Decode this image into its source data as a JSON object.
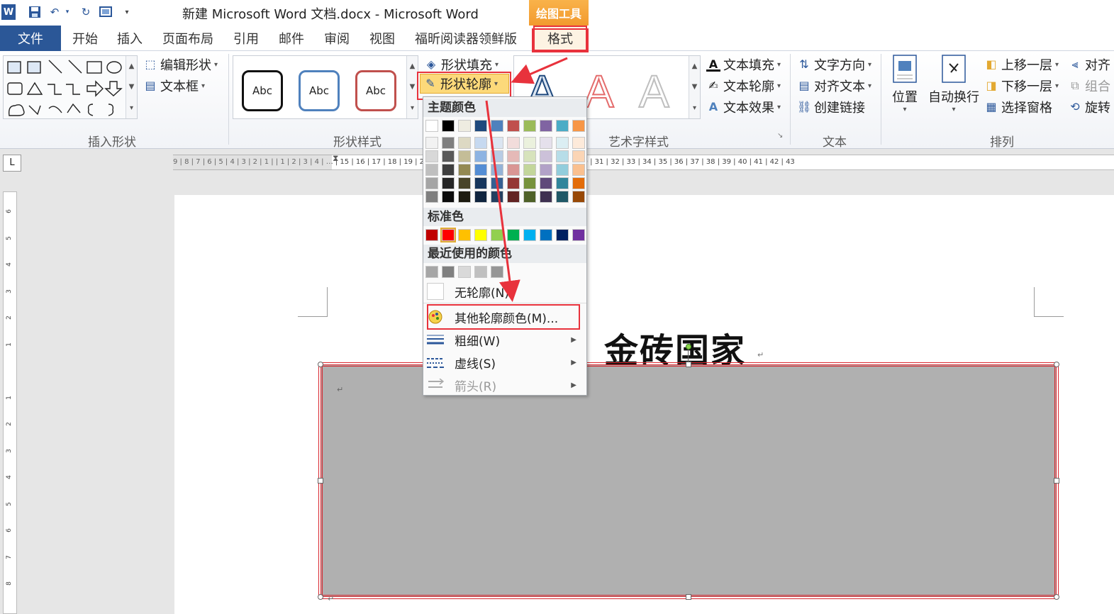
{
  "window": {
    "title": "新建 Microsoft Word 文档.docx - Microsoft Word",
    "context_tab": "绘图工具"
  },
  "quick_access": {
    "app_icon": "word-icon",
    "save_icon": "save-icon",
    "undo_icon": "undo-icon",
    "redo_icon": "redo-icon",
    "print_icon": "print-preview-icon",
    "customize_icon": "customize-icon"
  },
  "tabs": [
    {
      "label": "文件"
    },
    {
      "label": "开始"
    },
    {
      "label": "插入"
    },
    {
      "label": "页面布局"
    },
    {
      "label": "引用"
    },
    {
      "label": "邮件"
    },
    {
      "label": "审阅"
    },
    {
      "label": "视图"
    },
    {
      "label": "福昕阅读器领鲜版"
    },
    {
      "label": "格式"
    }
  ],
  "ribbon": {
    "insert_shapes": {
      "edit_shape": "编辑形状",
      "text_box": "文本框",
      "label": "插入形状"
    },
    "shape_styles": {
      "samples": [
        "Abc",
        "Abc",
        "Abc"
      ],
      "fill": "形状填充",
      "outline": "形状轮廓",
      "label": "形状样式"
    },
    "wordart": {
      "letters": [
        "A",
        "A",
        "A"
      ],
      "text_fill": "文本填充",
      "text_outline": "文本轮廓",
      "text_effects": "文本效果",
      "label": "艺术字样式"
    },
    "text": {
      "direction": "文字方向",
      "align": "对齐文本",
      "link": "创建链接",
      "label": "文本"
    },
    "arrange": {
      "position": "位置",
      "wrap": "自动换行",
      "bring_forward": "上移一层",
      "send_backward": "下移一层",
      "selection_pane": "选择窗格",
      "align": "对齐",
      "group": "组合",
      "rotate": "旋转",
      "label": "排列"
    }
  },
  "ruler": {
    "h_marks": "9 | 8 | 7 | 6 | 5 | 4 | 3 | 2 | 1 |  | 1 | 2 | 3 | 4 |     …     | 15 | 16 | 17 | 18 | 19 | 20 | 21 | 22 | 23 | 24 | 25 | 26 | 27 | 28 | 29 | 30 | 31 | 32 | 33 | 34 | 35 | 36 | 37 | 38 | 39 | 40 | 41 | 42 | 43",
    "v_marks": [
      "6",
      "5",
      "4",
      "3",
      "2",
      "1",
      "",
      "1",
      "2",
      "3",
      "4",
      "5",
      "6",
      "7",
      "8"
    ]
  },
  "document": {
    "heading": "金砖国家",
    "para_mark": "↵"
  },
  "dropdown": {
    "theme_colors_label": "主题颜色",
    "theme_top_row": [
      "#ffffff",
      "#000000",
      "#eeece1",
      "#1f497d",
      "#4f81bd",
      "#c0504d",
      "#9bbb59",
      "#8064a2",
      "#4bacc6",
      "#f79646"
    ],
    "theme_shades": [
      [
        "#f2f2f2",
        "#7f7f7f",
        "#ddd9c3",
        "#c6d9f0",
        "#dbe5f1",
        "#f2dcdb",
        "#ebf1dd",
        "#e5e0ec",
        "#dbeef3",
        "#fdeada"
      ],
      [
        "#d8d8d8",
        "#595959",
        "#c4bd97",
        "#8db3e2",
        "#b8cce4",
        "#e5b9b7",
        "#d7e3bc",
        "#ccc1d9",
        "#b7dde8",
        "#fbd5b5"
      ],
      [
        "#bfbfbf",
        "#3f3f3f",
        "#938953",
        "#548dd4",
        "#95b3d7",
        "#d99694",
        "#c3d69b",
        "#b2a2c7",
        "#92cddc",
        "#fac08f"
      ],
      [
        "#a5a5a5",
        "#262626",
        "#494429",
        "#17365d",
        "#366092",
        "#953734",
        "#76923c",
        "#5f497a",
        "#31859b",
        "#e36c09"
      ],
      [
        "#7f7f7f",
        "#0c0c0c",
        "#1d1b10",
        "#0f243e",
        "#244061",
        "#632423",
        "#4f6128",
        "#3f3151",
        "#205867",
        "#974806"
      ]
    ],
    "standard_colors_label": "标准色",
    "standard_colors": [
      "#c00000",
      "#ff0000",
      "#ffc000",
      "#ffff00",
      "#92d050",
      "#00b050",
      "#00b0f0",
      "#0070c0",
      "#002060",
      "#7030a0"
    ],
    "recent_colors_label": "最近使用的颜色",
    "recent_colors": [
      "#a6a6a6",
      "#808080",
      "#d9d9d9",
      "#c0c0c0",
      "#969696"
    ],
    "no_outline": "无轮廓(N)",
    "more_colors": "其他轮廓颜色(M)...",
    "weight": "粗细(W)",
    "dashes": "虚线(S)",
    "arrows": "箭头(R)"
  },
  "colors": {
    "accent_red": "#e8323c",
    "shape_fill": "#b0b0b0",
    "file_tab": "#2b5797",
    "context_orange": "#f29a2e"
  }
}
